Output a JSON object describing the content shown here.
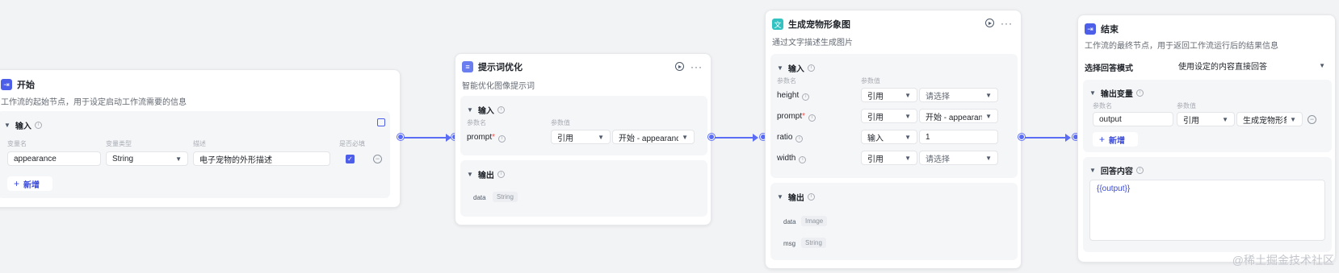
{
  "colors": {
    "canvas_bg": "#f2f3f5",
    "edge": "#5b6cf5",
    "start_icon": "#4d5ee8",
    "prompt_icon": "#6b7ef0",
    "image_icon": "#33c2c2",
    "end_icon": "#4d5ee8"
  },
  "start_node": {
    "icon": "start-icon",
    "title": "开始",
    "desc": "工作流的起始节点，用于设定启动工作流需要的信息",
    "input_title": "输入",
    "col_name": "变量名",
    "col_type": "变量类型",
    "col_desc": "描述",
    "col_required": "是否必填",
    "row": {
      "name": "appearance",
      "type": "String",
      "desc": "电子宠物的外形描述",
      "required": true
    },
    "add_label": "新增"
  },
  "prompt_node": {
    "icon": "document-icon",
    "title": "提示词优化",
    "desc": "智能优化图像提示词",
    "input_title": "输入",
    "col_param": "参数名",
    "col_value": "参数值",
    "param": "prompt",
    "mode": "引用",
    "value": "开始 - appearance",
    "output_title": "输出",
    "output_key": "data",
    "output_type": "String"
  },
  "image_node": {
    "icon": "image-gen-icon",
    "title": "生成宠物形象图",
    "desc": "通过文字描述生成图片",
    "input_title": "输入",
    "col_param": "参数名",
    "col_value": "参数值",
    "rows": [
      {
        "name": "height",
        "required": false,
        "mode": "引用",
        "value": "请选择",
        "placeholder": true,
        "dropdown": true
      },
      {
        "name": "prompt",
        "required": true,
        "mode": "引用",
        "value": "开始 - appearance",
        "placeholder": false,
        "dropdown": true
      },
      {
        "name": "ratio",
        "required": false,
        "mode": "输入",
        "value": "1",
        "placeholder": false,
        "dropdown": false
      },
      {
        "name": "width",
        "required": false,
        "mode": "引用",
        "value": "请选择",
        "placeholder": true,
        "dropdown": true
      }
    ],
    "output_title": "输出",
    "outputs": [
      {
        "key": "data",
        "type": "Image"
      },
      {
        "key": "msg",
        "type": "String"
      }
    ]
  },
  "end_node": {
    "icon": "end-icon",
    "title": "结束",
    "desc": "工作流的最终节点，用于返回工作流运行后的结果信息",
    "answer_mode_label": "选择回答模式",
    "answer_mode_value": "使用设定的内容直接回答",
    "output_var_title": "输出变量",
    "col_param": "参数名",
    "col_value": "参数值",
    "var_name": "output",
    "var_mode": "引用",
    "var_value": "生成宠物形象",
    "add_label": "新增",
    "answer_title": "回答内容",
    "answer_content": "{{output}}"
  },
  "watermark": "@稀土掘金技术社区"
}
